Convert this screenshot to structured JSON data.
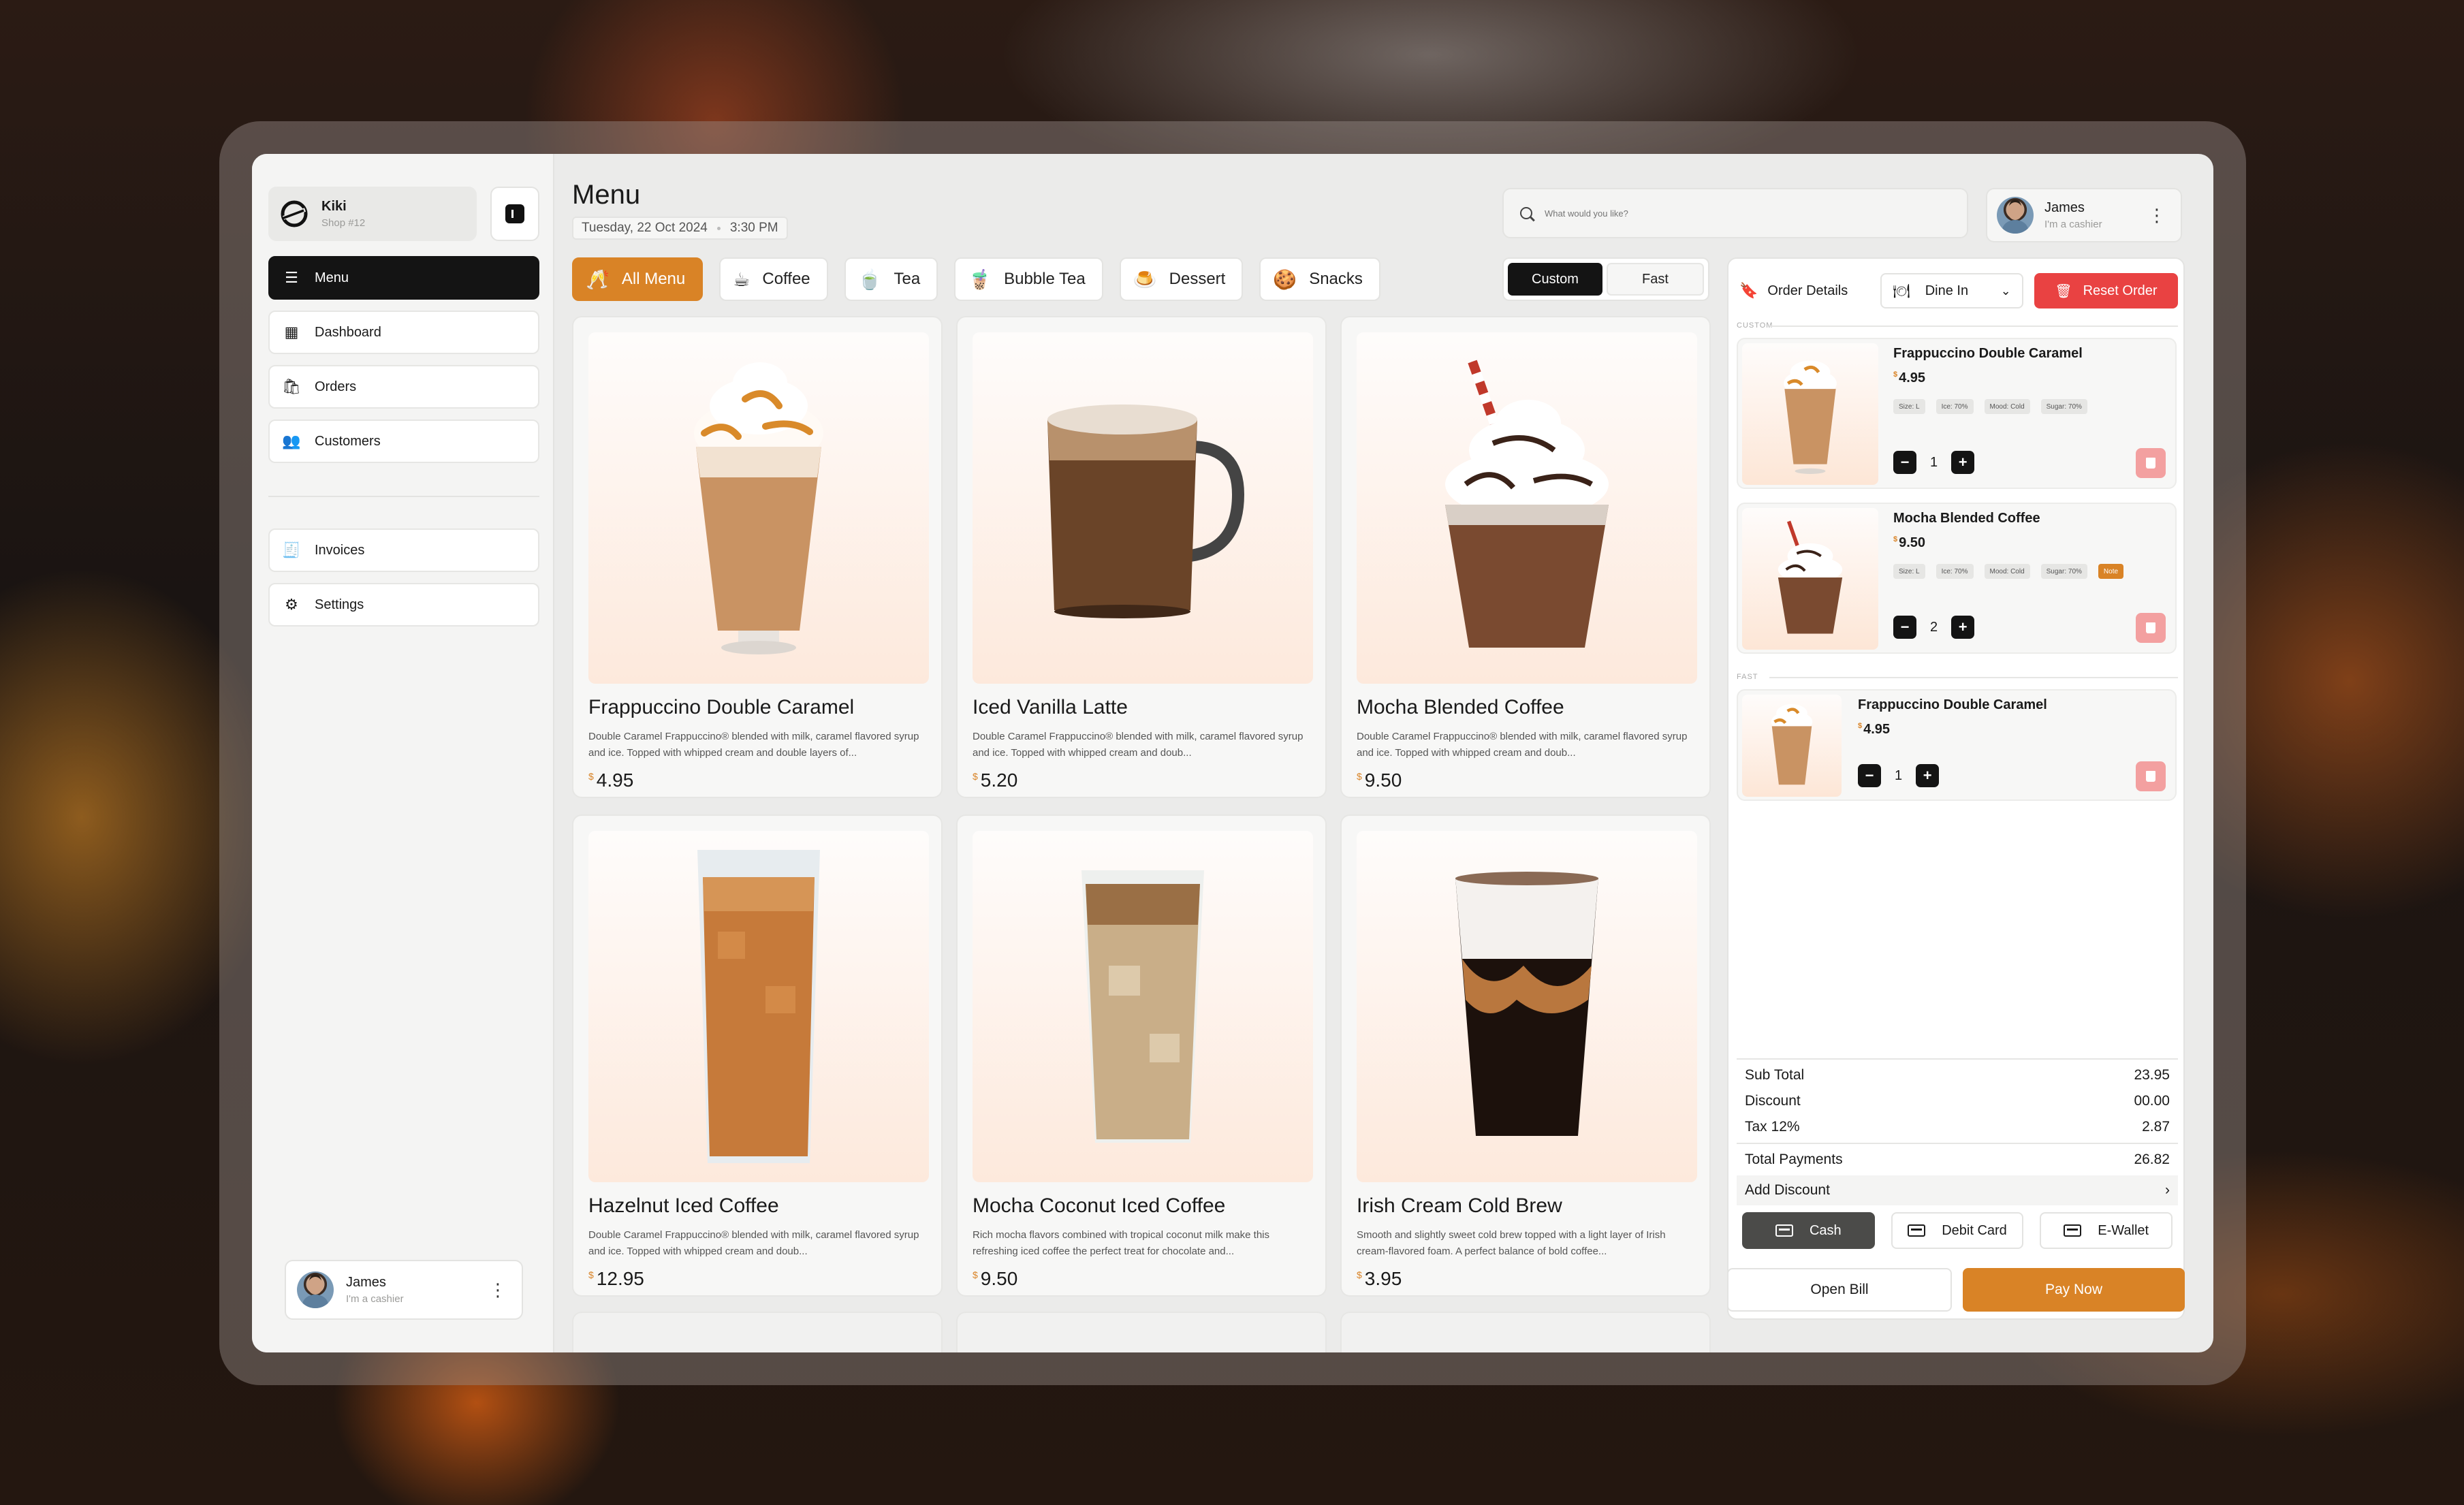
{
  "brand": {
    "name": "Kiki",
    "sub": "Shop #12"
  },
  "nav": [
    {
      "label": "Menu",
      "icon": "menu-icon",
      "active": true
    },
    {
      "label": "Dashboard",
      "icon": "dashboard-icon"
    },
    {
      "label": "Orders",
      "icon": "orders-icon"
    },
    {
      "label": "Customers",
      "icon": "customers-icon"
    },
    {
      "label": "Invoices",
      "icon": "invoices-icon"
    },
    {
      "label": "Settings",
      "icon": "settings-icon"
    }
  ],
  "sidebar_user": {
    "name": "James",
    "role": "I'm a cashier"
  },
  "header": {
    "title": "Menu",
    "date": "Tuesday, 22 Oct 2024",
    "time": "3:30 PM",
    "search_placeholder": "What would you like?",
    "user": {
      "name": "James",
      "role": "I'm a cashier"
    }
  },
  "categories": [
    {
      "label": "All Menu",
      "icon": "all-menu-icon",
      "active": true
    },
    {
      "label": "Coffee",
      "icon": "coffee-icon"
    },
    {
      "label": "Tea",
      "icon": "tea-icon"
    },
    {
      "label": "Bubble Tea",
      "icon": "bubble-tea-icon"
    },
    {
      "label": "Dessert",
      "icon": "dessert-icon"
    },
    {
      "label": "Snacks",
      "icon": "snacks-icon"
    }
  ],
  "mode_toggle": {
    "custom": "Custom",
    "fast": "Fast",
    "selected": "Custom"
  },
  "products": [
    {
      "name": "Frappuccino Double Caramel",
      "desc": "Double Caramel Frappuccino® blended with milk, caramel flavored syrup and ice. Topped with whipped cream and double layers of...",
      "currency": "$",
      "price": "4.95"
    },
    {
      "name": "Iced Vanilla Latte",
      "desc": "Double Caramel Frappuccino® blended with milk, caramel flavored syrup and ice. Topped with whipped cream and doub...",
      "currency": "$",
      "price": "5.20"
    },
    {
      "name": "Mocha Blended Coffee",
      "desc": "Double Caramel Frappuccino® blended with milk, caramel flavored syrup and ice. Topped with whipped cream and doub...",
      "currency": "$",
      "price": "9.50"
    },
    {
      "name": "Hazelnut Iced Coffee",
      "desc": "Double Caramel Frappuccino® blended with milk, caramel flavored syrup and ice. Topped with whipped cream and doub...",
      "currency": "$",
      "price": "12.95"
    },
    {
      "name": "Mocha Coconut Iced Coffee",
      "desc": "Rich mocha flavors combined with tropical coconut milk make this refreshing iced coffee the perfect treat for chocolate and...",
      "currency": "$",
      "price": "9.50"
    },
    {
      "name": "Irish Cream Cold Brew",
      "desc": "Smooth and slightly sweet cold brew topped with a light layer of Irish cream-flavored foam. A perfect balance of bold coffee...",
      "currency": "$",
      "price": "3.95"
    }
  ],
  "order": {
    "title": "Order Details",
    "dine_mode": "Dine In",
    "reset_label": "Reset Order",
    "custom_label": "CUSTOM",
    "fast_label": "FAST",
    "items": [
      {
        "name": "Frappuccino Double Caramel",
        "currency": "$",
        "price": "4.95",
        "tags": [
          "Size: L",
          "Ice: 70%",
          "Mood: Cold",
          "Sugar: 70%"
        ],
        "note": "",
        "qty": "1"
      },
      {
        "name": "Mocha Blended Coffee",
        "currency": "$",
        "price": "9.50",
        "tags": [
          "Size: L",
          "Ice: 70%",
          "Mood: Cold",
          "Sugar: 70%"
        ],
        "note": "Note",
        "qty": "2"
      },
      {
        "name": "Frappuccino Double Caramel",
        "currency": "$",
        "price": "4.95",
        "tags": [],
        "note": "",
        "qty": "1"
      }
    ],
    "summary": {
      "sub_total_label": "Sub Total",
      "sub_total": "23.95",
      "discount_label": "Discount",
      "discount": "00.00",
      "tax_label": "Tax 12%",
      "tax": "2.87",
      "total_label": "Total Payments",
      "total": "26.82",
      "add_discount_label": "Add Discount"
    },
    "payment_methods": [
      {
        "label": "Cash",
        "icon": "cash-icon",
        "selected": true
      },
      {
        "label": "Debit Card",
        "icon": "debit-card-icon"
      },
      {
        "label": "E-Wallet",
        "icon": "e-wallet-icon"
      }
    ],
    "open_bill_label": "Open Bill",
    "pay_now_label": "Pay Now"
  },
  "colors": {
    "accent": "#d98326",
    "danger": "#e94242",
    "dark": "#141414"
  }
}
